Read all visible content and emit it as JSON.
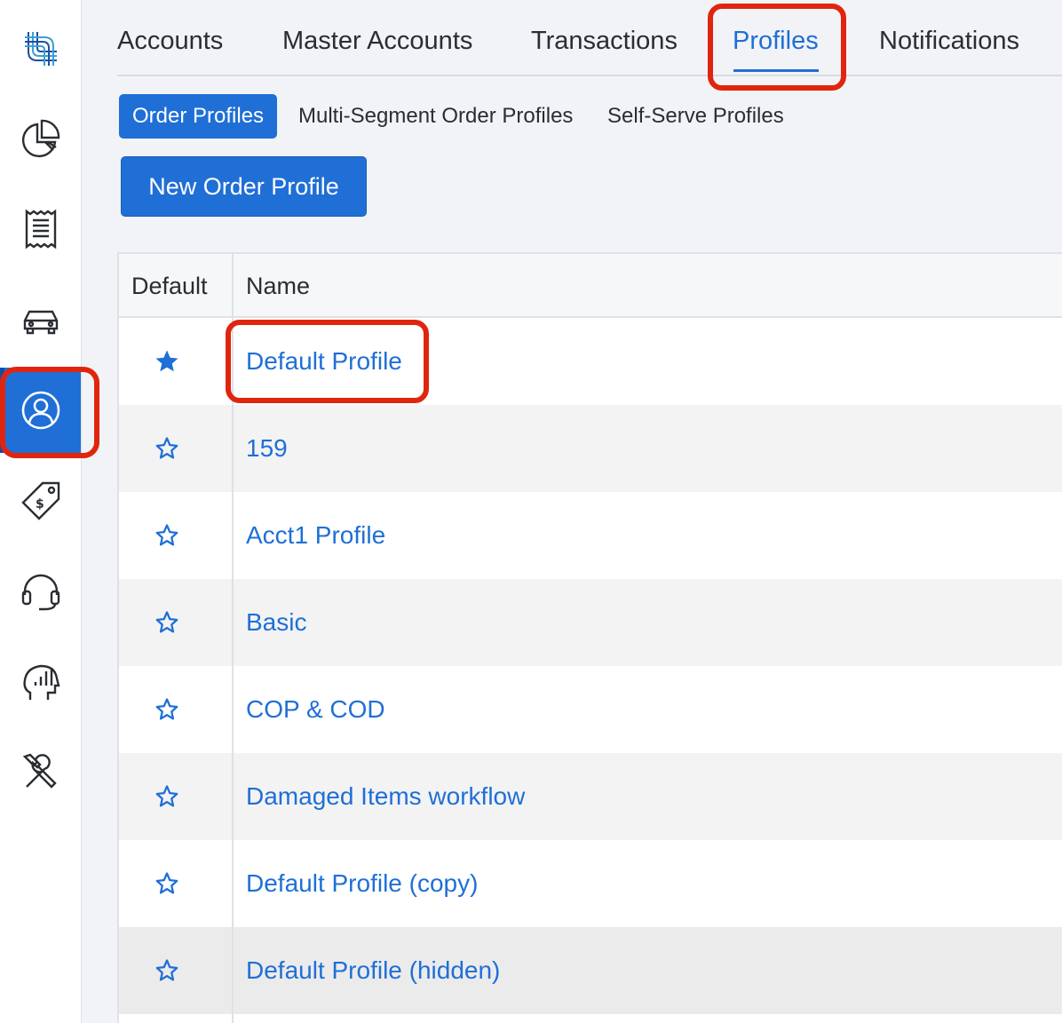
{
  "top_tabs": [
    {
      "label": "Accounts"
    },
    {
      "label": "Master Accounts"
    },
    {
      "label": "Transactions"
    },
    {
      "label": "Profiles",
      "active": true
    },
    {
      "label": "Notifications"
    }
  ],
  "sub_tabs": [
    {
      "label": "Order Profiles",
      "active": true
    },
    {
      "label": "Multi-Segment Order Profiles"
    },
    {
      "label": "Self-Serve Profiles"
    }
  ],
  "new_button": "New Order Profile",
  "table": {
    "headers": [
      "Default",
      "Name"
    ],
    "rows": [
      {
        "name": "Default Profile",
        "default": true
      },
      {
        "name": "159",
        "default": false
      },
      {
        "name": "Acct1 Profile",
        "default": false
      },
      {
        "name": "Basic",
        "default": false
      },
      {
        "name": "COP & COD",
        "default": false
      },
      {
        "name": "Damaged Items workflow",
        "default": false
      },
      {
        "name": "Default Profile (copy)",
        "default": false
      },
      {
        "name": "Default Profile (hidden)",
        "default": false
      }
    ]
  },
  "sidebar_icons": [
    "logo-icon",
    "pie-chart-icon",
    "receipt-icon",
    "car-icon",
    "user-profile-icon",
    "price-tag-icon",
    "headset-icon",
    "analytics-head-icon",
    "tools-icon"
  ],
  "colors": {
    "accent": "#1f6fd6",
    "highlight": "#e0250f"
  }
}
